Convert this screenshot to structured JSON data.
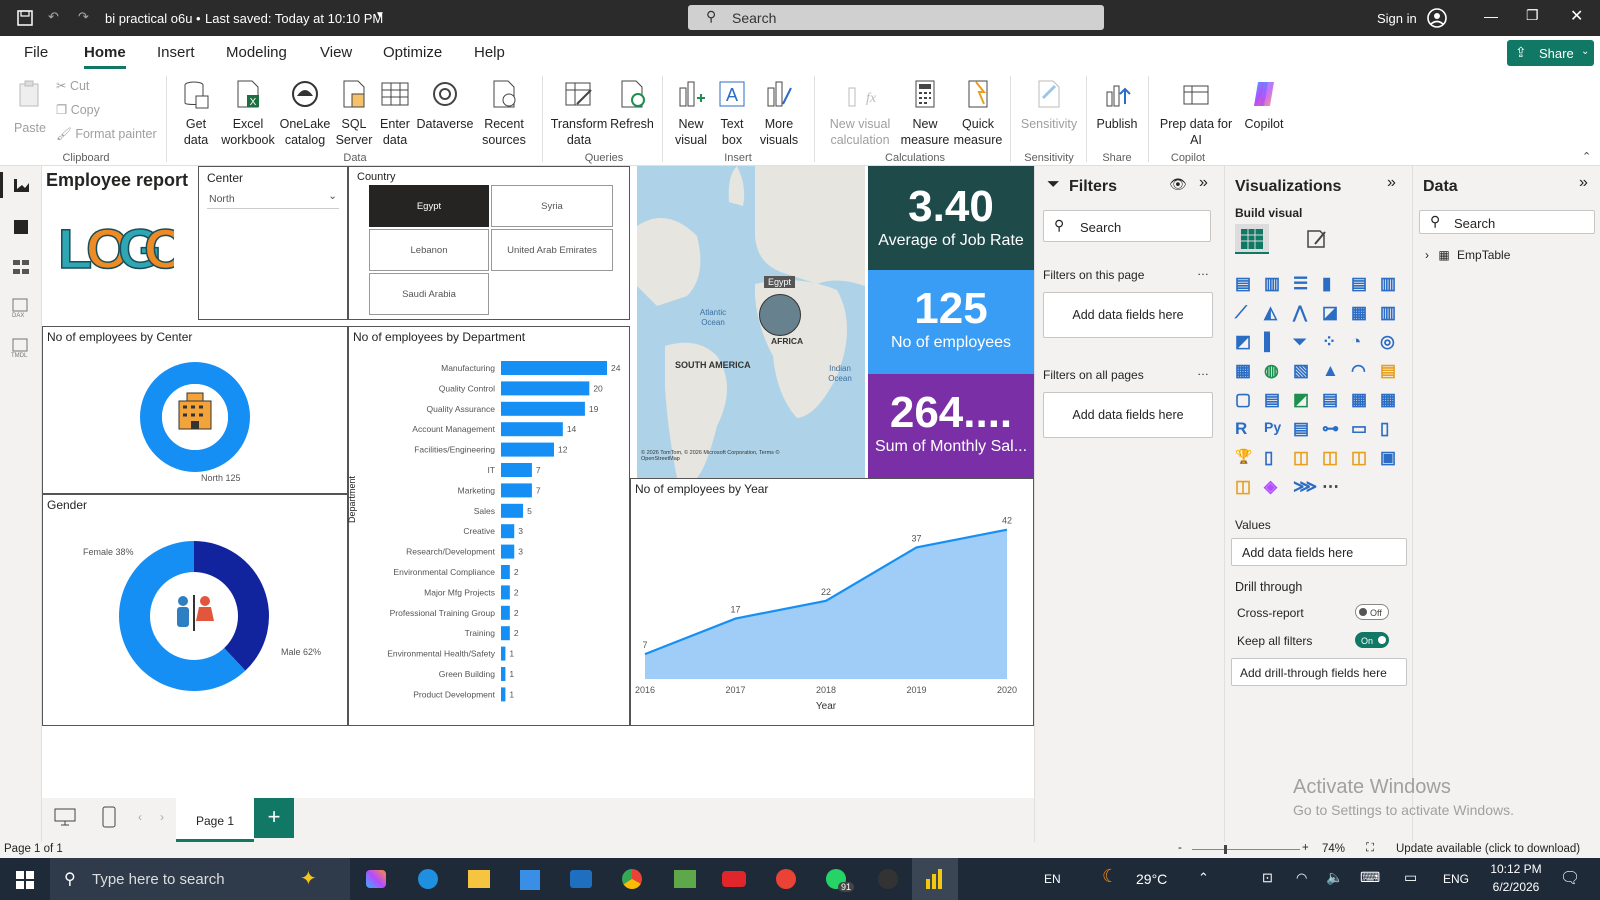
{
  "titlebar": {
    "file_title": "bi practical o6u",
    "saved": "Last saved: Today at 10:10 PM",
    "search": "Search",
    "signin": "Sign in"
  },
  "menu": [
    "File",
    "Home",
    "Insert",
    "Modeling",
    "View",
    "Optimize",
    "Help"
  ],
  "share": "Share",
  "ribbon": {
    "paste": "Paste",
    "cut": "Cut",
    "copy": "Copy",
    "format_painter": "Format painter",
    "get_data": "Get data",
    "excel": "Excel workbook",
    "onelake": "OneLake catalog",
    "sql": "SQL Server",
    "enter": "Enter data",
    "dataverse": "Dataverse",
    "recent": "Recent sources",
    "transform": "Transform data",
    "refresh": "Refresh",
    "new_visual": "New visual",
    "text_box": "Text box",
    "more_visuals": "More visuals",
    "new_visual_calc": "New visual calculation",
    "new_measure": "New measure",
    "quick_measure": "Quick measure",
    "sensitivity": "Sensitivity",
    "publish": "Publish",
    "prep": "Prep data for AI",
    "copilot": "Copilot",
    "groups": {
      "clipboard": "Clipboard",
      "data": "Data",
      "queries": "Queries",
      "insert": "Insert",
      "calculations": "Calculations",
      "sensitivity": "Sensitivity",
      "share": "Share",
      "copilot": "Copilot"
    }
  },
  "report": {
    "title": "Employee report",
    "logo_text": "LOGO",
    "center_slicer": {
      "title": "Center",
      "value": "North"
    },
    "country_slicer": {
      "title": "Country",
      "options": [
        "Egypt",
        "Syria",
        "Lebanon",
        "United Arab Emirates",
        "Saudi Arabia"
      ],
      "selected": "Egypt"
    },
    "map": {
      "labels": [
        "Atlantic Ocean",
        "SOUTH AMERICA",
        "AFRICA",
        "Indian Ocean",
        "Egypt"
      ],
      "credit": "© 2026 TomTom, © 2026 Microsoft Corporation, Terms © OpenStreetMap"
    },
    "kpis": [
      {
        "value": "3.40",
        "label": "Average of Job Rate",
        "color": "#1e4a4a"
      },
      {
        "value": "125",
        "label": "No of employees",
        "color": "#3a9df5"
      },
      {
        "value": "264....",
        "label": "Sum of Monthly Sal...",
        "color": "#7a2fa6"
      }
    ],
    "center_donut": {
      "title": "No of employees by Center",
      "label": "North 125"
    },
    "gender": {
      "title": "Gender",
      "female": "Female 38%",
      "male": "Male 62%"
    }
  },
  "chart_data": [
    {
      "type": "bar",
      "title": "No of employees by Department",
      "ylabel": "Department",
      "categories": [
        "Manufacturing",
        "Quality Control",
        "Quality Assurance",
        "Account Management",
        "Facilities/Engineering",
        "IT",
        "Marketing",
        "Sales",
        "Creative",
        "Research/Development",
        "Environmental Compliance",
        "Major Mfg Projects",
        "Professional Training Group",
        "Training",
        "Environmental Health/Safety",
        "Green Building",
        "Product Development"
      ],
      "values": [
        24,
        20,
        19,
        14,
        12,
        7,
        7,
        5,
        3,
        3,
        2,
        2,
        2,
        2,
        1,
        1,
        1
      ]
    },
    {
      "type": "area",
      "title": "No of employees by Year",
      "xlabel": "Year",
      "x": [
        2016,
        2017,
        2018,
        2019,
        2020
      ],
      "values": [
        7,
        17,
        22,
        37,
        42
      ],
      "ylim": [
        0,
        45
      ]
    },
    {
      "type": "pie",
      "title": "Gender",
      "categories": [
        "Female",
        "Male"
      ],
      "values": [
        38,
        62
      ]
    },
    {
      "type": "pie",
      "title": "No of employees by Center",
      "categories": [
        "North"
      ],
      "values": [
        125
      ]
    }
  ],
  "filters": {
    "title": "Filters",
    "search": "Search",
    "on_page": "Filters on this page",
    "all_pages": "Filters on all pages",
    "add": "Add data fields here"
  },
  "viz": {
    "title": "Visualizations",
    "build": "Build visual",
    "values": "Values",
    "add": "Add data fields here",
    "drill": "Drill through",
    "cross": "Cross-report",
    "cross_state": "Off",
    "keep": "Keep all filters",
    "keep_state": "On",
    "add_drill": "Add drill-through fields here"
  },
  "data": {
    "title": "Data",
    "search": "Search",
    "table": "EmpTable"
  },
  "pagebar": {
    "page": "Page 1"
  },
  "status": {
    "page": "Page 1 of 1",
    "zoom": "74%",
    "update": "Update available (click to download)"
  },
  "watermark": {
    "line1": "Activate Windows",
    "line2": "Go to Settings to activate Windows."
  },
  "taskbar": {
    "search": "Type here to search",
    "temp": "29°C",
    "lang": "ENG",
    "lang2": "EN",
    "time": "10:12 PM",
    "date": "6/2/2026",
    "badge": "91"
  }
}
